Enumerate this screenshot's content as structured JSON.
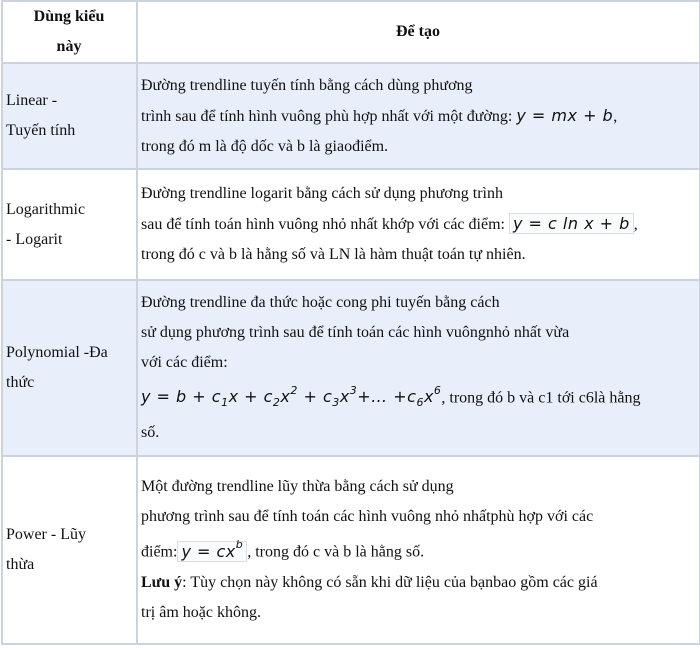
{
  "table": {
    "headers": {
      "col1": "Dùng kiểu này",
      "col1_line1": "Dùng kiểu",
      "col1_line2": "này",
      "col2": "Để tạo"
    },
    "colors": {
      "border": "#ccd3de",
      "shaded_row": "#e8eefa",
      "plain_row": "#ffffff"
    },
    "rows": [
      {
        "type_line1": "Linear -",
        "type_line2": "Tuyến tính",
        "desc_line1": "Đường trendline tuyến tính bằng cách dùng phương",
        "desc_line2": "trình sau để tính hình vuông phù hợp nhất với một đường: ",
        "formula": "y = mx + b",
        "desc_line2_end": ",",
        "desc_line3": "trong đó m là độ dốc và b là giaođiểm."
      },
      {
        "type_line1": "Logarithmic",
        "type_line2": "- Logarit",
        "desc_line1": "Đường trendline logarit bằng cách sử dụng phương trình",
        "desc_line2": "sau để tính toán hình vuông nhỏ nhất khớp với các điểm: ",
        "formula": "y = c ln x + b",
        "desc_line2_end": ",",
        "desc_line3": "trong đó c và b là hằng số và LN là hàm thuật toán tự nhiên."
      },
      {
        "type_line1": "Polynomial -Đa",
        "type_line2": "thức",
        "desc_line1": "Đường trendline đa thức hoặc cong phi tuyến bằng cách",
        "desc_line2": "sử dụng phương trình sau để tính toán các hình vuôngnhỏ nhất vừa",
        "desc_line3": "với các điểm:",
        "formula_parts": {
          "y": "y = b + c",
          "s1": "1",
          "x1": "x + c",
          "s2": "2",
          "x2": "x",
          "p2": "2",
          "plus3": " + c",
          "s3": "3",
          "x3": "x",
          "p3": "3",
          "dots": "+… +c",
          "s6": "6",
          "x6": "x",
          "p6": "6"
        },
        "desc_line4_end": ", trong đó b và c1 tới c6là hằng",
        "desc_line5": "số."
      },
      {
        "type_line1": "Power - Lũy",
        "type_line2": "thừa",
        "desc_line1": "Một đường trendline lũy thừa bằng cách sử dụng",
        "desc_line2": "phương trình sau để tính toán các hình vuông nhỏ nhấtphù hợp với các",
        "desc_line3_start": "điểm:",
        "formula_base": "y = cx",
        "formula_exp": "b",
        "desc_line3_end": ", trong đó c và b là hằng số.",
        "note_label": "Lưu ý",
        "note_text": ": Tùy chọn này không có sẵn khi dữ liệu của bạnbao gồm các giá",
        "note_line2": "trị âm hoặc không."
      }
    ]
  }
}
